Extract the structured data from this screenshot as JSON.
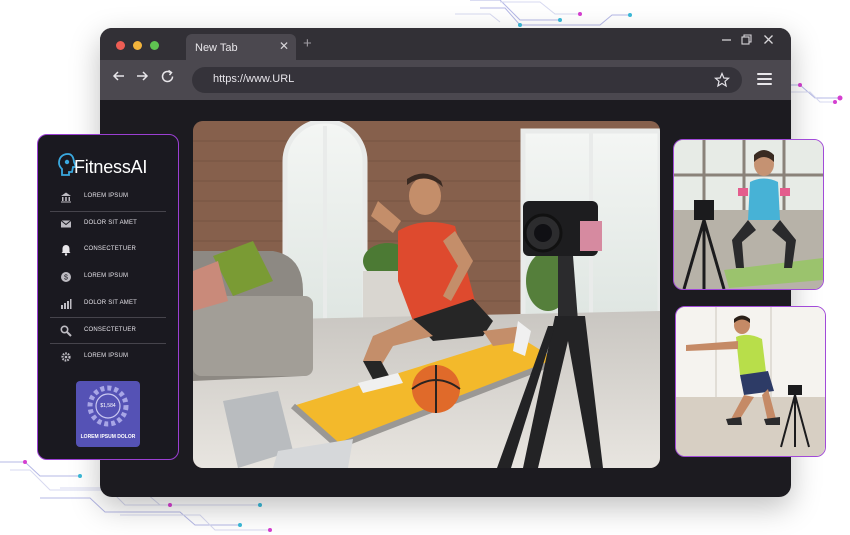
{
  "browser": {
    "tab_title": "New Tab",
    "tab_close": "✕",
    "new_tab": "+",
    "url": "https://www.URL",
    "window_controls": [
      "minimize-icon",
      "restore-icon",
      "close-icon"
    ]
  },
  "sidebar": {
    "brand": "FitnessAI",
    "items": [
      {
        "label": "LOREM IPSUM",
        "icon": "bank-icon"
      },
      {
        "label": "DOLOR SIT AMET",
        "icon": "mail-icon"
      },
      {
        "label": "CONSECTETUER",
        "icon": "bell-icon"
      },
      {
        "label": "LOREM IPSUM",
        "icon": "dollar-icon"
      },
      {
        "label": "DOLOR SIT AMET",
        "icon": "chart-icon"
      },
      {
        "label": "CONSECTETUER",
        "icon": "search-icon"
      },
      {
        "label": "LOREM IPSUM",
        "icon": "gear-icon"
      }
    ],
    "promo": {
      "amount": "$1,584",
      "label": "LOREM IPSUM DOLOR"
    }
  },
  "colors": {
    "accent_purple": "#9b3fd3",
    "circuit_cyan": "#3bb9d8",
    "circuit_magenta": "#d53fd0",
    "promo_blue": "#5552b5"
  }
}
